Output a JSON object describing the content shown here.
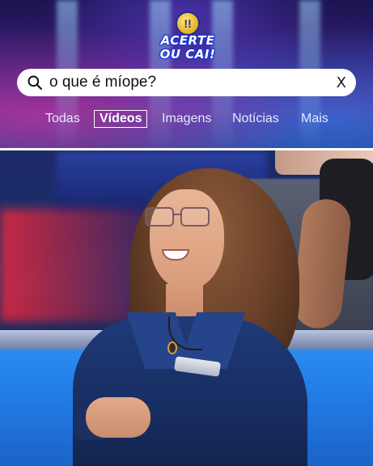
{
  "logo": {
    "line1": "ACERTE",
    "line2": "OU CAI",
    "badge_glyph": "!!",
    "mark": "!"
  },
  "search": {
    "query": "o que é míope?",
    "search_icon": "search-icon",
    "clear_label": "X"
  },
  "tabs": [
    {
      "label": "Todas",
      "active": false
    },
    {
      "label": "Vídeos",
      "active": true
    },
    {
      "label": "Imagens",
      "active": false
    },
    {
      "label": "Notícias",
      "active": false
    },
    {
      "label": "Mais",
      "active": false
    }
  ],
  "colors": {
    "search_bg": "#ffffff",
    "tab_text": "#e6e9ff",
    "active_tab_border": "#ffffff",
    "floor_blue": "#2b8cf0",
    "jacket_navy": "#1f3a78"
  },
  "video": {
    "content": "contestant-frame"
  }
}
